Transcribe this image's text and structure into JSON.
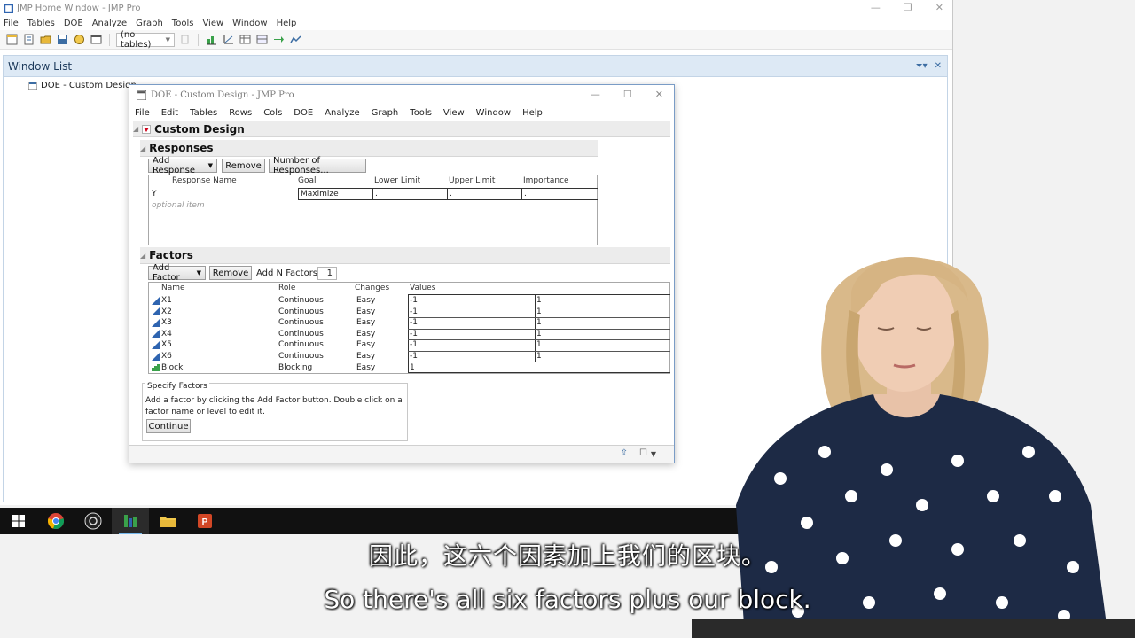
{
  "home_window": {
    "title": "JMP Home Window - JMP Pro",
    "menu": [
      "File",
      "Tables",
      "DOE",
      "Analyze",
      "Graph",
      "Tools",
      "View",
      "Window",
      "Help"
    ],
    "toolbar_select": "(no tables)",
    "window_list_title": "Window List",
    "window_list_items": [
      "DOE - Custom Design"
    ]
  },
  "doe_window": {
    "title": "DOE - Custom Design - JMP Pro",
    "menu": [
      "File",
      "Edit",
      "Tables",
      "Rows",
      "Cols",
      "DOE",
      "Analyze",
      "Graph",
      "Tools",
      "View",
      "Window",
      "Help"
    ],
    "platform_title": "Custom Design",
    "responses": {
      "section_title": "Responses",
      "buttons": {
        "add": "Add Response",
        "remove": "Remove",
        "number": "Number of Responses..."
      },
      "columns": [
        "Response Name",
        "Goal",
        "Lower Limit",
        "Upper Limit",
        "Importance"
      ],
      "rows": [
        {
          "name": "Y",
          "goal": "Maximize",
          "lower": ".",
          "upper": ".",
          "importance": "."
        }
      ],
      "optional_item": "optional item"
    },
    "factors": {
      "section_title": "Factors",
      "buttons": {
        "add": "Add Factor",
        "remove": "Remove"
      },
      "add_n_label": "Add N Factors",
      "add_n_value": "1",
      "columns": [
        "Name",
        "Role",
        "Changes",
        "Values"
      ],
      "rows": [
        {
          "name": "X1",
          "role": "Continuous",
          "changes": "Easy",
          "low": "-1",
          "high": "1"
        },
        {
          "name": "X2",
          "role": "Continuous",
          "changes": "Easy",
          "low": "-1",
          "high": "1"
        },
        {
          "name": "X3",
          "role": "Continuous",
          "changes": "Easy",
          "low": "-1",
          "high": "1"
        },
        {
          "name": "X4",
          "role": "Continuous",
          "changes": "Easy",
          "low": "-1",
          "high": "1"
        },
        {
          "name": "X5",
          "role": "Continuous",
          "changes": "Easy",
          "low": "-1",
          "high": "1"
        },
        {
          "name": "X6",
          "role": "Continuous",
          "changes": "Easy",
          "low": "-1",
          "high": "1"
        },
        {
          "name": "Block",
          "role": "Blocking",
          "changes": "Easy",
          "low": "1",
          "high": ""
        }
      ]
    },
    "specify_factors": {
      "title": "Specify Factors",
      "text": "Add a factor by clicking the Add Factor button. Double click on a factor name or level to edit it.",
      "continue_label": "Continue"
    }
  },
  "subtitles": {
    "chinese": "因此，这六个因素加上我们的区块。",
    "english": "So there's all six factors plus our block."
  },
  "colors": {
    "accent": "#3c6da3",
    "red_triangle": "#d0021b",
    "continuous_icon": "#2e64b0",
    "blocking_icon": "#3aa14a"
  }
}
